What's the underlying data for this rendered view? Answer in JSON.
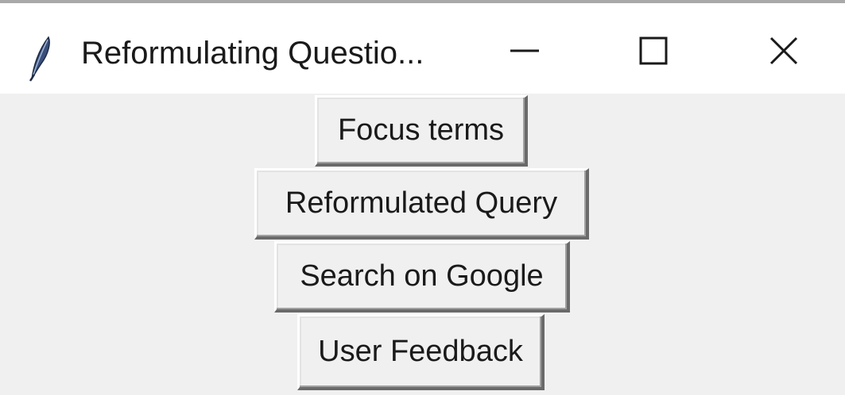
{
  "window": {
    "title": "Reformulating Questio...",
    "icon": "feather-icon",
    "controls": {
      "minimize_icon": "minimize-icon",
      "maximize_icon": "maximize-icon",
      "close_icon": "close-icon"
    }
  },
  "buttons": [
    {
      "label": "Focus terms"
    },
    {
      "label": "Reformulated Query"
    },
    {
      "label": "Search on Google"
    },
    {
      "label": "User Feedback"
    }
  ],
  "colors": {
    "window_background": "#f0f0f0",
    "titlebar_background": "#ffffff",
    "text": "#1a1a1a"
  }
}
